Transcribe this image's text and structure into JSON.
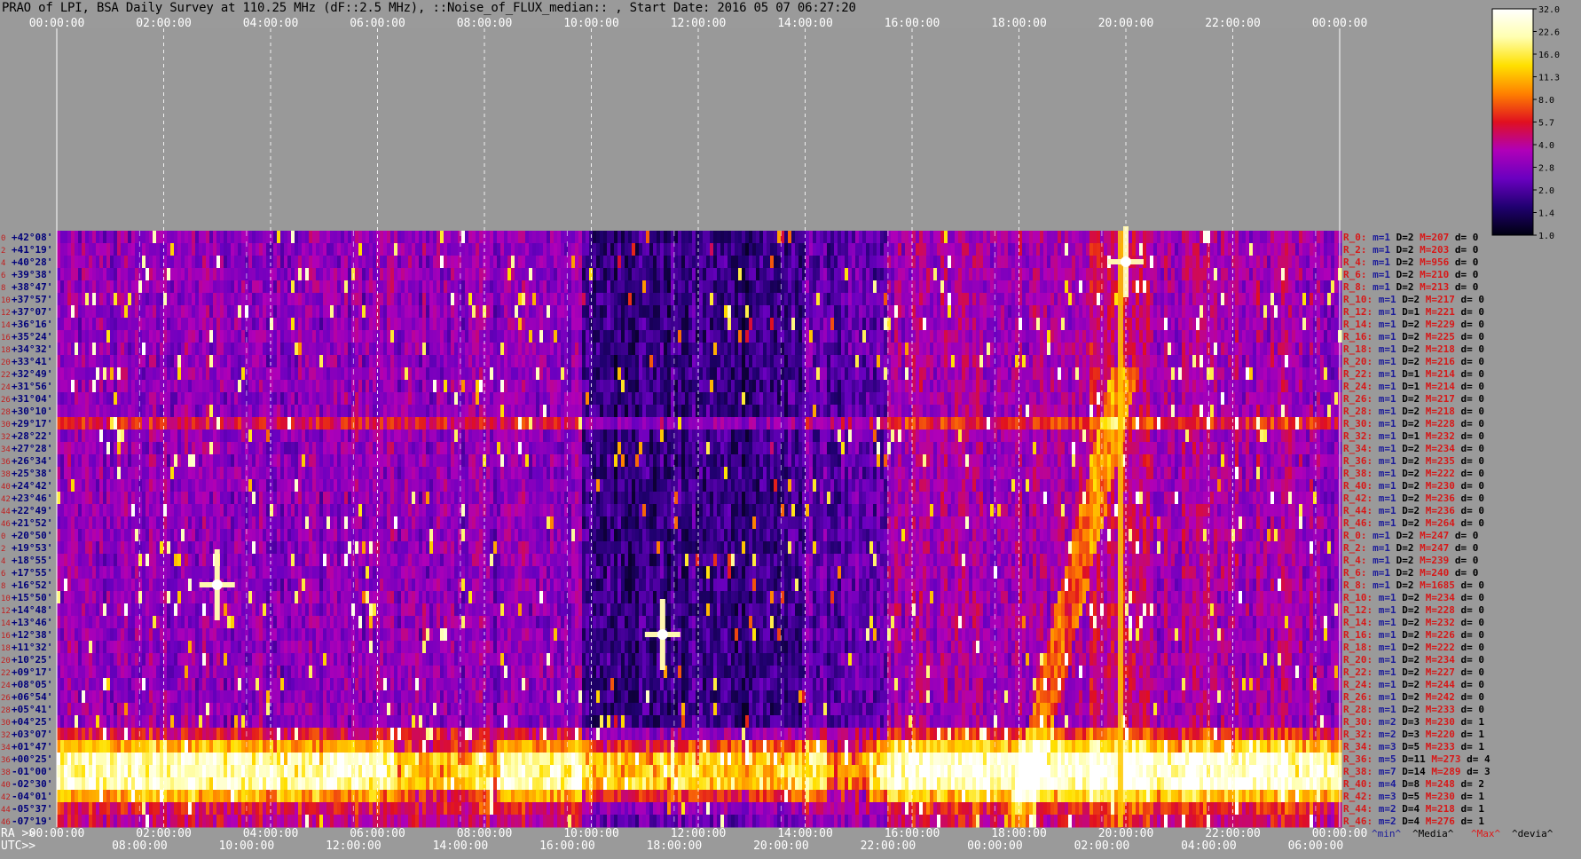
{
  "title": "PRAO of LPI, BSA Daily Survey at 110.25 MHz (dF::2.5 MHz), ::Noise_of_FLUX_median:: , Start Date: 2016 05 07 06:27:20",
  "colors": {
    "background": "#9a9a9a",
    "plot_grey_area": "#999999",
    "left_labels": "#00007a",
    "left_index": "#c02020",
    "right_R": "#d81818",
    "right_m": "#1a1a9a",
    "right_D": "#000000",
    "right_M": "#d81818",
    "right_d": "#000000"
  },
  "chart_data": {
    "type": "heatmap",
    "description_hidden": "",
    "x_top_ticks": [
      "00:00:00",
      "02:00:00",
      "04:00:00",
      "06:00:00",
      "08:00:00",
      "10:00:00",
      "12:00:00",
      "14:00:00",
      "16:00:00",
      "18:00:00",
      "20:00:00",
      "22:00:00",
      "00:00:00"
    ],
    "x_ra_axis_label": "RA >>",
    "x_ra_ticks": [
      "00:00:00",
      "02:00:00",
      "04:00:00",
      "06:00:00",
      "08:00:00",
      "10:00:00",
      "12:00:00",
      "14:00:00",
      "16:00:00",
      "18:00:00",
      "20:00:00",
      "22:00:00",
      "00:00:00"
    ],
    "x_utc_axis_label": "UTC>>",
    "x_utc_ticks": [
      "08:00:00",
      "10:00:00",
      "12:00:00",
      "14:00:00",
      "16:00:00",
      "18:00:00",
      "20:00:00",
      "22:00:00",
      "00:00:00",
      "02:00:00",
      "04:00:00",
      "06:00:00"
    ],
    "y_declinations": [
      "+42°08'",
      "+41°19'",
      "+40°28'",
      "+39°38'",
      "+38°47'",
      "+37°57'",
      "+37°07'",
      "+36°16'",
      "+35°24'",
      "+34°32'",
      "+33°41'",
      "+32°49'",
      "+31°56'",
      "+31°04'",
      "+30°10'",
      "+29°17'",
      "+28°22'",
      "+27°28'",
      "+26°34'",
      "+25°38'",
      "+24°42'",
      "+23°46'",
      "+22°49'",
      "+21°52'",
      "+20°50'",
      "+19°53'",
      "+18°55'",
      "+17°55'",
      "+16°52'",
      "+15°50'",
      "+14°48'",
      "+13°46'",
      "+12°38'",
      "+11°32'",
      "+10°25'",
      "+09°17'",
      "+08°05'",
      "+06°54'",
      "+05°41'",
      "+04°25'",
      "+03°07'",
      "+01°47'",
      "+00°25'",
      "-01°00'",
      "-02°30'",
      "-04°01'",
      "-05°37'",
      "-07°19'"
    ],
    "y_index": [
      "0",
      "2",
      "4",
      "6",
      "8",
      "10",
      "12",
      "14",
      "16",
      "18",
      "20",
      "22",
      "24",
      "26",
      "28",
      "30",
      "32",
      "34",
      "36",
      "38",
      "40",
      "42",
      "44",
      "46",
      "0",
      "2",
      "4",
      "6",
      "8",
      "10",
      "12",
      "14",
      "16",
      "18",
      "20",
      "22",
      "24",
      "26",
      "28",
      "30",
      "32",
      "34",
      "36",
      "38",
      "40",
      "42",
      "44",
      "46"
    ],
    "colorbar": {
      "ticks": [
        "32.0",
        "22.6",
        "16.0",
        "11.3",
        "8.0",
        "5.7",
        "4.0",
        "2.8",
        "2.0",
        "1.4",
        "1.0"
      ],
      "range": [
        1.0,
        32.0
      ],
      "scale": "log",
      "palette": [
        "#000010",
        "#200070",
        "#6a00c0",
        "#b000b8",
        "#e01020",
        "#ff8000",
        "#ffe000",
        "#ffffb0",
        "#ffffff"
      ]
    },
    "channel_stats": {
      "rows": [
        {
          "r": "R_0:",
          "m": "m=1",
          "D": "D=2",
          "M": "M=207",
          "d": "d= 0"
        },
        {
          "r": "R_2:",
          "m": "m=1",
          "D": "D=2",
          "M": "M=203",
          "d": "d= 0"
        },
        {
          "r": "R_4:",
          "m": "m=1",
          "D": "D=2",
          "M": "M=956",
          "d": "d= 0"
        },
        {
          "r": "R_6:",
          "m": "m=1",
          "D": "D=2",
          "M": "M=210",
          "d": "d= 0"
        },
        {
          "r": "R_8:",
          "m": "m=1",
          "D": "D=2",
          "M": "M=213",
          "d": "d= 0"
        },
        {
          "r": "R_10:",
          "m": "m=1",
          "D": "D=2",
          "M": "M=217",
          "d": "d= 0"
        },
        {
          "r": "R_12:",
          "m": "m=1",
          "D": "D=1",
          "M": "M=221",
          "d": "d= 0"
        },
        {
          "r": "R_14:",
          "m": "m=1",
          "D": "D=2",
          "M": "M=229",
          "d": "d= 0"
        },
        {
          "r": "R_16:",
          "m": "m=1",
          "D": "D=2",
          "M": "M=225",
          "d": "d= 0"
        },
        {
          "r": "R_18:",
          "m": "m=1",
          "D": "D=2",
          "M": "M=218",
          "d": "d= 0"
        },
        {
          "r": "R_20:",
          "m": "m=1",
          "D": "D=2",
          "M": "M=216",
          "d": "d= 0"
        },
        {
          "r": "R_22:",
          "m": "m=1",
          "D": "D=1",
          "M": "M=214",
          "d": "d= 0"
        },
        {
          "r": "R_24:",
          "m": "m=1",
          "D": "D=1",
          "M": "M=214",
          "d": "d= 0"
        },
        {
          "r": "R_26:",
          "m": "m=1",
          "D": "D=2",
          "M": "M=217",
          "d": "d= 0"
        },
        {
          "r": "R_28:",
          "m": "m=1",
          "D": "D=2",
          "M": "M=218",
          "d": "d= 0"
        },
        {
          "r": "R_30:",
          "m": "m=1",
          "D": "D=2",
          "M": "M=228",
          "d": "d= 0"
        },
        {
          "r": "R_32:",
          "m": "m=1",
          "D": "D=1",
          "M": "M=232",
          "d": "d= 0"
        },
        {
          "r": "R_34:",
          "m": "m=1",
          "D": "D=2",
          "M": "M=234",
          "d": "d= 0"
        },
        {
          "r": "R_36:",
          "m": "m=1",
          "D": "D=2",
          "M": "M=235",
          "d": "d= 0"
        },
        {
          "r": "R_38:",
          "m": "m=1",
          "D": "D=2",
          "M": "M=222",
          "d": "d= 0"
        },
        {
          "r": "R_40:",
          "m": "m=1",
          "D": "D=2",
          "M": "M=230",
          "d": "d= 0"
        },
        {
          "r": "R_42:",
          "m": "m=1",
          "D": "D=2",
          "M": "M=236",
          "d": "d= 0"
        },
        {
          "r": "R_44:",
          "m": "m=1",
          "D": "D=2",
          "M": "M=236",
          "d": "d= 0"
        },
        {
          "r": "R_46:",
          "m": "m=1",
          "D": "D=2",
          "M": "M=264",
          "d": "d= 0"
        },
        {
          "r": "R_0:",
          "m": "m=1",
          "D": "D=2",
          "M": "M=247",
          "d": "d= 0"
        },
        {
          "r": "R_2:",
          "m": "m=1",
          "D": "D=2",
          "M": "M=247",
          "d": "d= 0"
        },
        {
          "r": "R_4:",
          "m": "m=1",
          "D": "D=2",
          "M": "M=239",
          "d": "d= 0"
        },
        {
          "r": "R_6:",
          "m": "m=1",
          "D": "D=2",
          "M": "M=240",
          "d": "d= 0"
        },
        {
          "r": "R_8:",
          "m": "m=1",
          "D": "D=2",
          "M": "M=1685",
          "d": "d= 0"
        },
        {
          "r": "R_10:",
          "m": "m=1",
          "D": "D=2",
          "M": "M=234",
          "d": "d= 0"
        },
        {
          "r": "R_12:",
          "m": "m=1",
          "D": "D=2",
          "M": "M=228",
          "d": "d= 0"
        },
        {
          "r": "R_14:",
          "m": "m=1",
          "D": "D=2",
          "M": "M=232",
          "d": "d= 0"
        },
        {
          "r": "R_16:",
          "m": "m=1",
          "D": "D=2",
          "M": "M=226",
          "d": "d= 0"
        },
        {
          "r": "R_18:",
          "m": "m=1",
          "D": "D=2",
          "M": "M=222",
          "d": "d= 0"
        },
        {
          "r": "R_20:",
          "m": "m=1",
          "D": "D=2",
          "M": "M=234",
          "d": "d= 0"
        },
        {
          "r": "R_22:",
          "m": "m=1",
          "D": "D=2",
          "M": "M=227",
          "d": "d= 0"
        },
        {
          "r": "R_24:",
          "m": "m=1",
          "D": "D=2",
          "M": "M=244",
          "d": "d= 0"
        },
        {
          "r": "R_26:",
          "m": "m=1",
          "D": "D=2",
          "M": "M=242",
          "d": "d= 0"
        },
        {
          "r": "R_28:",
          "m": "m=1",
          "D": "D=2",
          "M": "M=233",
          "d": "d= 0"
        },
        {
          "r": "R_30:",
          "m": "m=2",
          "D": "D=3",
          "M": "M=230",
          "d": "d= 1"
        },
        {
          "r": "R_32:",
          "m": "m=2",
          "D": "D=3",
          "M": "M=220",
          "d": "d= 1"
        },
        {
          "r": "R_34:",
          "m": "m=3",
          "D": "D=5",
          "M": "M=233",
          "d": "d= 1"
        },
        {
          "r": "R_36:",
          "m": "m=5",
          "D": "D=11",
          "M": "M=273",
          "d": "d= 4"
        },
        {
          "r": "R_38:",
          "m": "m=7",
          "D": "D=14",
          "M": "M=289",
          "d": "d= 3"
        },
        {
          "r": "R_40:",
          "m": "m=4",
          "D": "D=8",
          "M": "M=248",
          "d": "d= 2"
        },
        {
          "r": "R_42:",
          "m": "m=3",
          "D": "D=5",
          "M": "M=230",
          "d": "d= 1"
        },
        {
          "r": "R_44:",
          "m": "m=2",
          "D": "D=4",
          "M": "M=218",
          "d": "d= 1"
        },
        {
          "r": "R_46:",
          "m": "m=2",
          "D": "D=4",
          "M": "M=276",
          "d": "d= 1"
        }
      ],
      "footer": {
        "min": "^min^",
        "media": "^Media^",
        "max": "^Max^",
        "devia": "^devia^"
      }
    },
    "features": {
      "bright_band_declinations": [
        "+00°25'",
        "-01°00'",
        "-02°30'"
      ],
      "horizontal_line_declination": "+29°17'",
      "bright_sources": [
        {
          "ra": "20:00:00",
          "dec": "+40°28'"
        },
        {
          "ra": "03:00:00",
          "dec": "+16°52'"
        },
        {
          "ra": "11:20:00",
          "dec": "+12°38'"
        }
      ]
    }
  }
}
